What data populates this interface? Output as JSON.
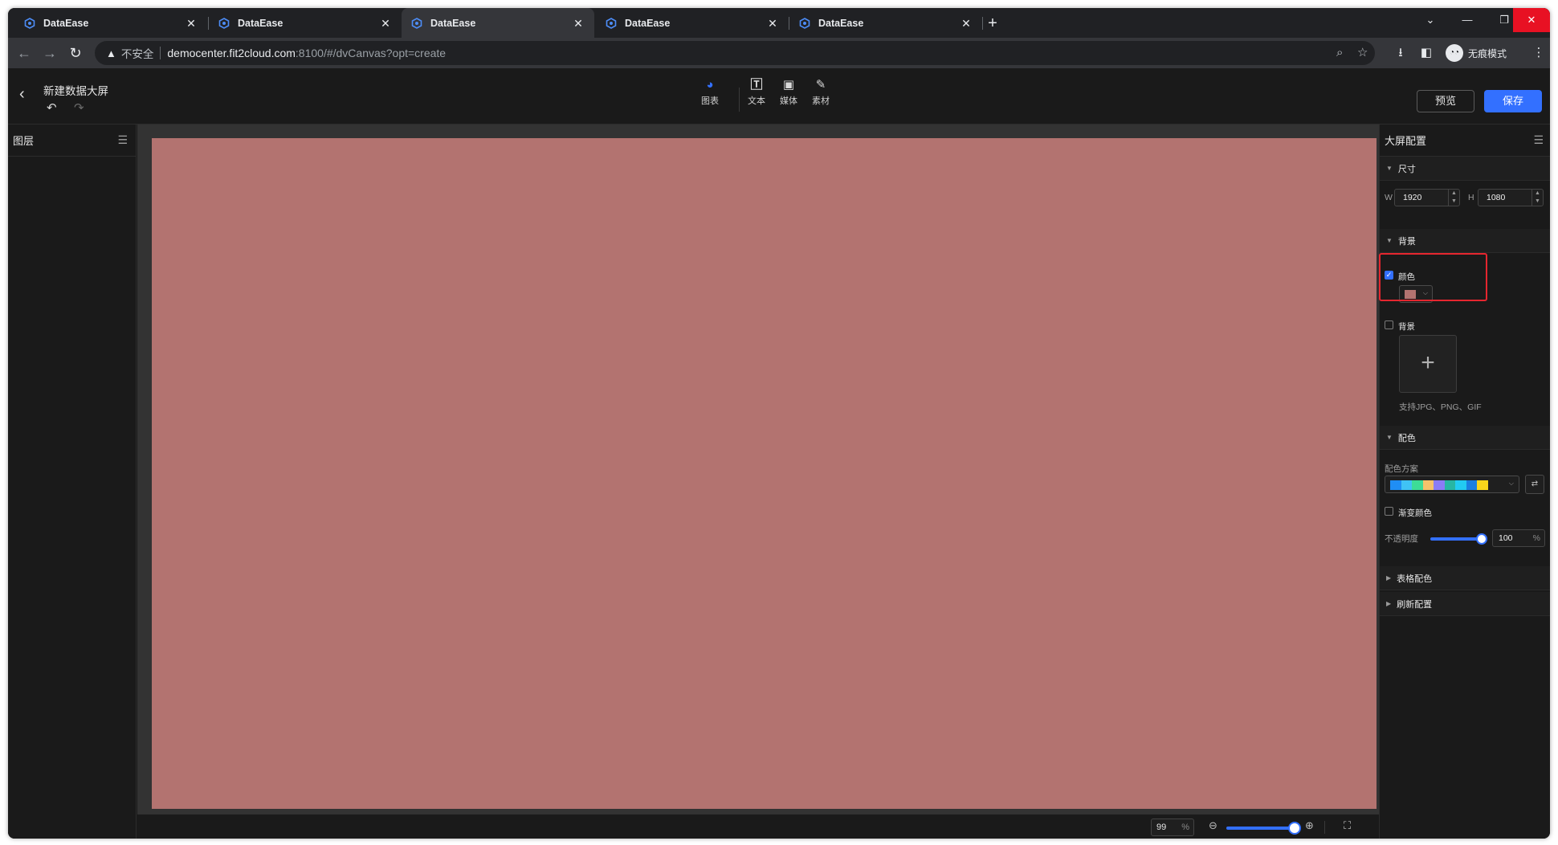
{
  "browser": {
    "tabs": [
      {
        "title": "DataEase",
        "active": false
      },
      {
        "title": "DataEase",
        "active": false
      },
      {
        "title": "DataEase",
        "active": true
      },
      {
        "title": "DataEase",
        "active": false
      },
      {
        "title": "DataEase",
        "active": false
      }
    ],
    "new_tab": "+",
    "security_label": "不安全",
    "url_host": "democenter.fit2cloud.com",
    "url_path": ":8100/#/dvCanvas?opt=create",
    "profile_label": "无痕模式",
    "profile_icon": "incognito-icon"
  },
  "header": {
    "title": "新建数据大屏",
    "tools": [
      {
        "label": "图表",
        "icon": "chart-pie-icon"
      },
      {
        "label": "文本",
        "icon": "text-icon"
      },
      {
        "label": "媒体",
        "icon": "media-image-icon"
      },
      {
        "label": "素材",
        "icon": "material-palette-icon"
      }
    ],
    "preview_label": "预览",
    "save_label": "保存"
  },
  "layers": {
    "title": "图层"
  },
  "canvas": {
    "background_color": "#b37370",
    "zoom_value": "99",
    "zoom_unit": "%",
    "zoom_level_fraction": 0.85
  },
  "config": {
    "title": "大屏配置",
    "sections": {
      "size": {
        "title": "尺寸",
        "w_label": "W",
        "w_value": "1920",
        "h_label": "H",
        "h_value": "1080"
      },
      "background": {
        "title": "背景",
        "color_label": "颜色",
        "color_checked": true,
        "color_value": "#b37370",
        "image_label": "背景",
        "image_checked": false,
        "upload_plus": "+",
        "upload_hint": "支持JPG、PNG、GIF"
      },
      "palette": {
        "title": "配色",
        "scheme_label": "配色方案",
        "scheme_colors": [
          "#1f8ef5",
          "#40c3f5",
          "#3ddc97",
          "#f5c26b",
          "#8a7cf6",
          "#27b6a3",
          "#22cbf2",
          "#1a7fe0",
          "#f8d51b"
        ],
        "gradient_label": "渐变颜色",
        "gradient_checked": false,
        "opacity_label": "不透明度",
        "opacity_value": "100",
        "opacity_unit": "%",
        "opacity_fraction": 1.0
      },
      "table_color": {
        "title": "表格配色"
      },
      "refresh": {
        "title": "刷新配置"
      }
    }
  }
}
